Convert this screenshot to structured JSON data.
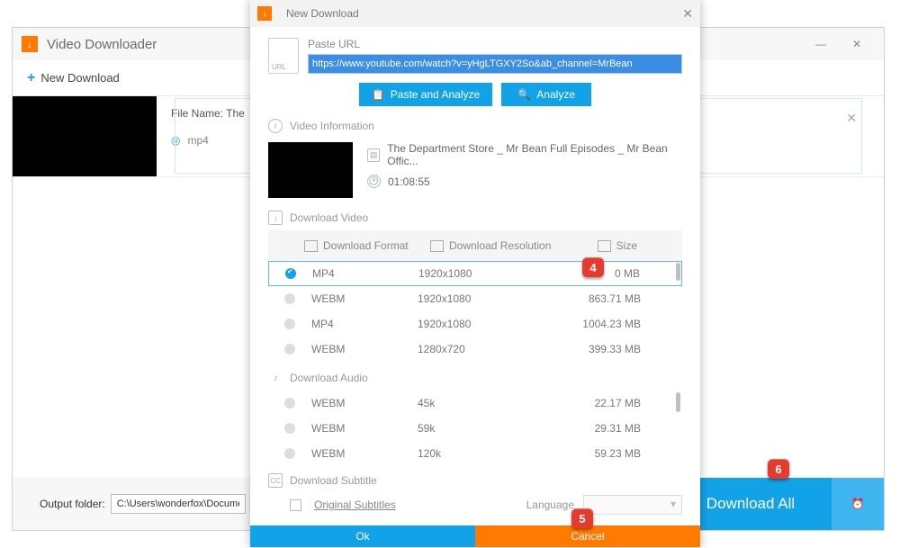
{
  "main": {
    "title": "Video Downloader",
    "new_download": "New Download",
    "clear": "C",
    "file_name_label": "File Name: The",
    "mp4_label": "mp4",
    "output_label": "Output folder:",
    "output_path": "C:\\Users\\wonderfox\\Documents\\W",
    "download_all": "Download All"
  },
  "dialog": {
    "title": "New Download",
    "paste_url_label": "Paste URL",
    "url_value": "https://www.youtube.com/watch?v=yHgLTGXY2So&ab_channel=MrBean",
    "paste_analyze": "Paste and Analyze",
    "analyze": "Analyze",
    "video_info_label": "Video Information",
    "video_title": "The Department Store _ Mr Bean Full Episodes _ Mr Bean Offic...",
    "duration": "01:08:55",
    "download_video_label": "Download Video",
    "head_format": "Download Format",
    "head_res": "Download Resolution",
    "head_size": "Size",
    "video_rows": [
      {
        "fmt": "MP4",
        "res": "1920x1080",
        "size": "0 MB",
        "selected": true
      },
      {
        "fmt": "WEBM",
        "res": "1920x1080",
        "size": "863.71 MB"
      },
      {
        "fmt": "MP4",
        "res": "1920x1080",
        "size": "1004.23 MB"
      },
      {
        "fmt": "WEBM",
        "res": "1280x720",
        "size": "399.33 MB"
      }
    ],
    "download_audio_label": "Download Audio",
    "audio_rows": [
      {
        "fmt": "WEBM",
        "res": "45k",
        "size": "22.17 MB"
      },
      {
        "fmt": "WEBM",
        "res": "59k",
        "size": "29.31 MB"
      },
      {
        "fmt": "WEBM",
        "res": "120k",
        "size": "59.23 MB"
      }
    ],
    "download_sub_label": "Download Subtitle",
    "original_sub": "Original Subtitles",
    "language_label": "Language",
    "ok": "Ok",
    "cancel": "Cancel"
  },
  "steps": {
    "s4": "4",
    "s5": "5",
    "s6": "6"
  }
}
